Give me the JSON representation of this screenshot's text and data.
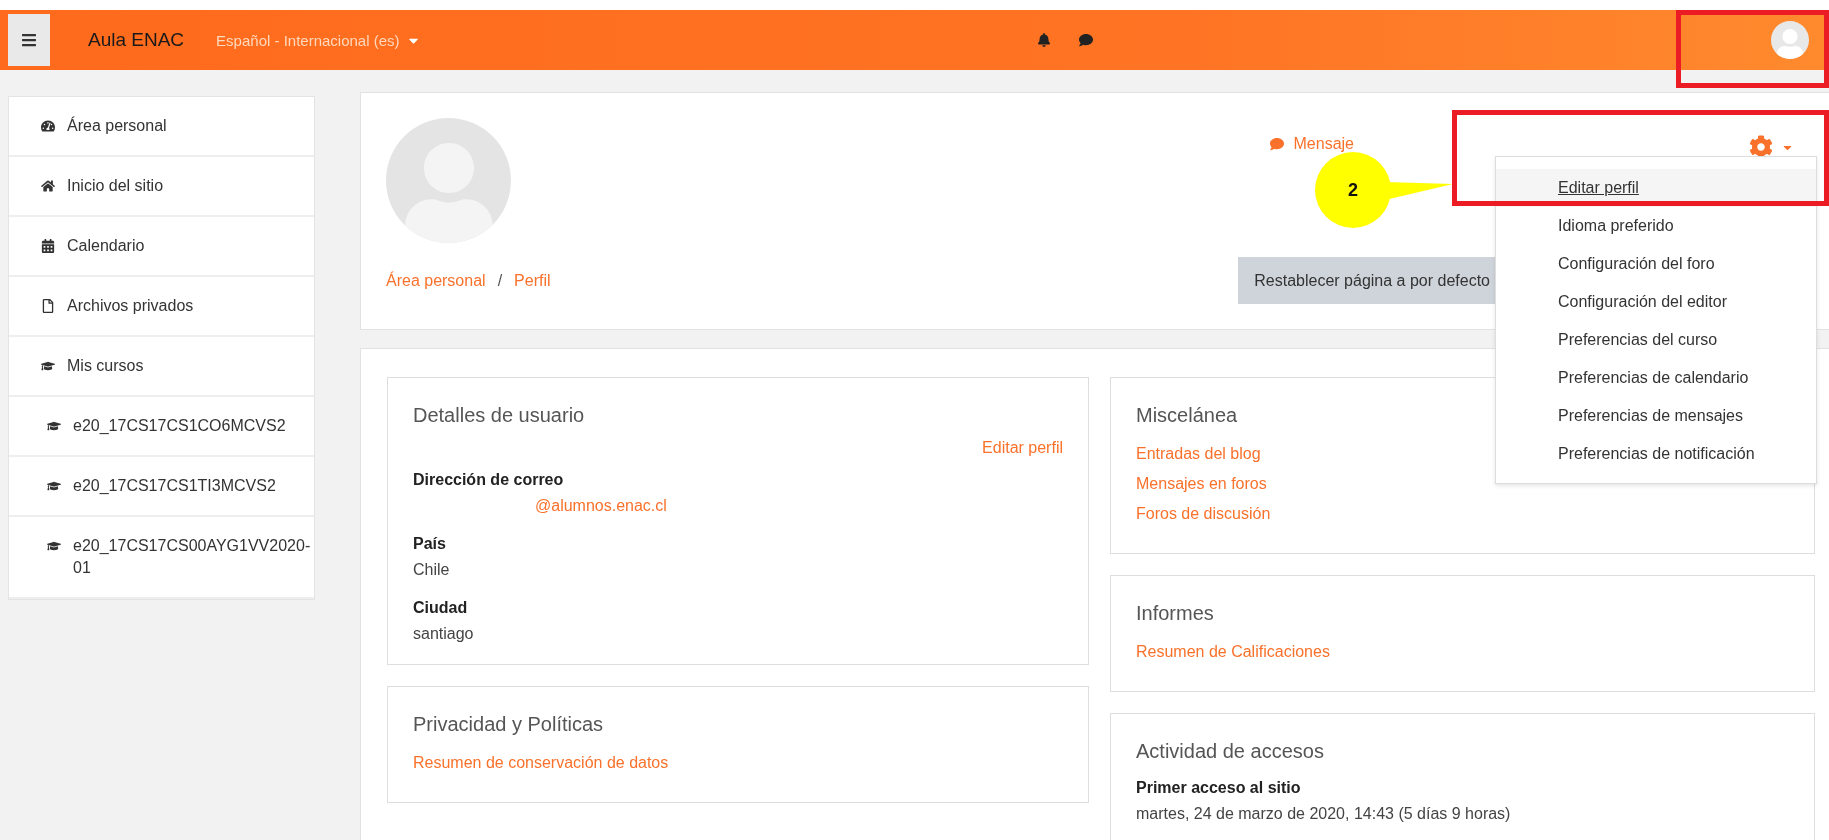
{
  "navbar": {
    "site_name": "Aula ENAC",
    "language": "Español - Internacional (es)"
  },
  "sidebar": {
    "items": [
      {
        "kind": "dashboard",
        "label": "Área personal"
      },
      {
        "kind": "home",
        "label": "Inicio del sitio"
      },
      {
        "kind": "calendar",
        "label": "Calendario"
      },
      {
        "kind": "file",
        "label": "Archivos privados"
      },
      {
        "kind": "courses",
        "label": "Mis cursos",
        "children": [
          {
            "kind": "course",
            "label": "e20_17CS17CS1CO6MCVS2"
          },
          {
            "kind": "course",
            "label": "e20_17CS17CS1TI3MCVS2"
          },
          {
            "kind": "course",
            "label": "e20_17CS17CS00AYG1VV2020-01"
          }
        ]
      }
    ]
  },
  "header": {
    "message_link": "Mensaje",
    "breadcrumb": [
      "Área personal",
      "Perfil"
    ],
    "breadcrumb_separator": "/",
    "reset_button": "Restablecer página a por defecto"
  },
  "settings_menu": {
    "items": [
      {
        "label": "Editar perfil",
        "selected": true
      },
      {
        "label": "Idioma preferido",
        "selected": false
      },
      {
        "label": "Configuración del foro",
        "selected": false
      },
      {
        "label": "Configuración del editor",
        "selected": false
      },
      {
        "label": "Preferencias del curso",
        "selected": false
      },
      {
        "label": "Preferencias de calendario",
        "selected": false
      },
      {
        "label": "Preferencias de mensajes",
        "selected": false
      },
      {
        "label": "Preferencias de notificación",
        "selected": false
      }
    ]
  },
  "user_details": {
    "title": "Detalles de usuario",
    "edit_link": "Editar perfil",
    "fields": [
      {
        "label": "Dirección de correo",
        "value": "@alumnos.enac.cl",
        "kind": "email"
      },
      {
        "label": "País",
        "value": "Chile",
        "kind": "text"
      },
      {
        "label": "Ciudad",
        "value": "santiago",
        "kind": "text"
      }
    ]
  },
  "privacy": {
    "title": "Privacidad y Políticas",
    "links": [
      "Resumen de conservación de datos"
    ]
  },
  "misc": {
    "title": "Miscelánea",
    "links": [
      "Entradas del blog",
      "Mensajes en foros",
      "Foros de discusión"
    ]
  },
  "reports": {
    "title": "Informes",
    "links": [
      "Resumen de Calificaciones"
    ]
  },
  "access": {
    "title": "Actividad de accesos",
    "label": "Primer acceso al sitio",
    "value": "martes, 24 de marzo de 2020, 14:43  (5 días 9 horas)"
  },
  "annotation": {
    "number": "2"
  }
}
